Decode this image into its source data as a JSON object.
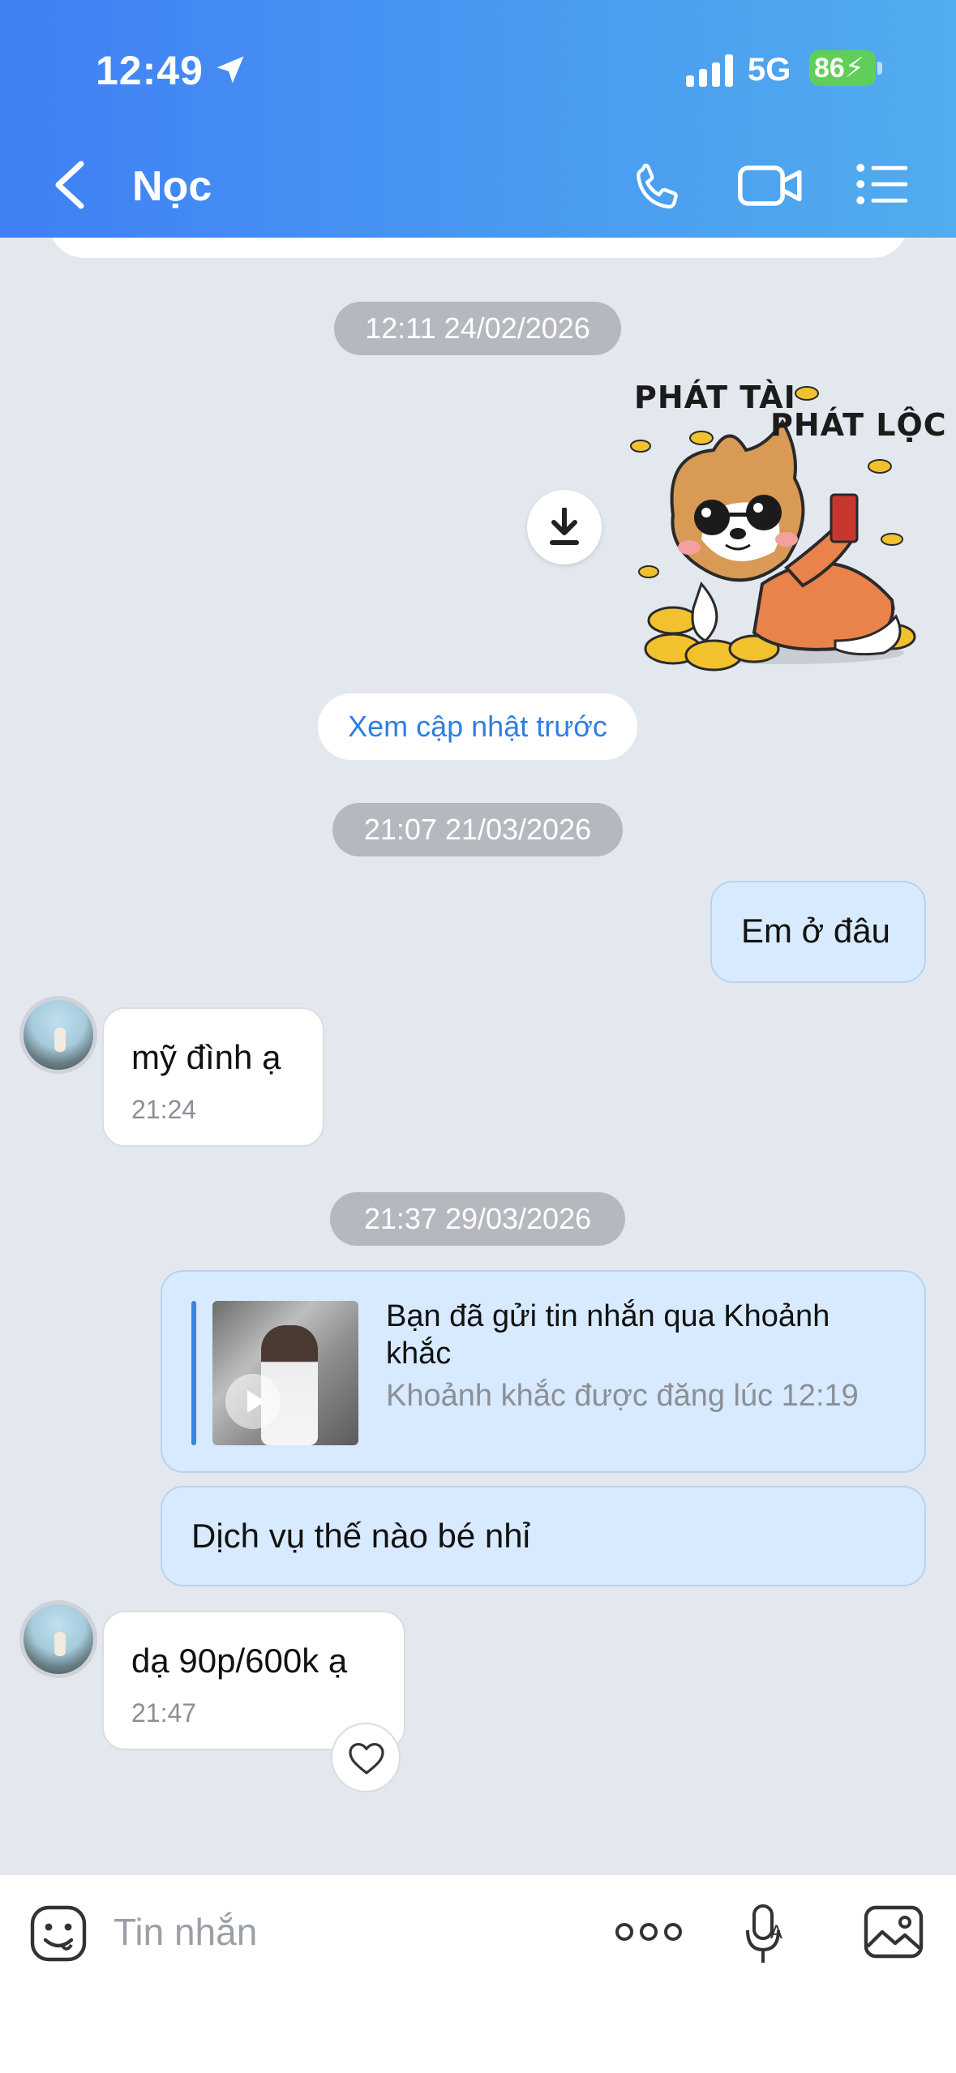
{
  "status_bar": {
    "time": "12:49",
    "network": "5G",
    "battery": "86"
  },
  "header": {
    "title": "Nọc"
  },
  "messages": {
    "timestamp1": "12:11 24/02/2026",
    "sticker_text_line1": "PHÁT TÀI",
    "sticker_text_line2": "PHÁT LỘC",
    "see_previous": "Xem cập nhật trước",
    "timestamp2": "21:07 21/03/2026",
    "out1": "Em ở đâu",
    "in1_text": "mỹ đình ạ",
    "in1_time": "21:24",
    "timestamp3": "21:37 29/03/2026",
    "moment_title": "Bạn đã gửi tin nhắn qua Khoảnh khắc",
    "moment_sub": "Khoảnh khắc được đăng lúc 12:19",
    "out2": "Dịch vụ thế nào bé nhỉ",
    "in2_text": "dạ 90p/600k ạ",
    "in2_time": "21:47"
  },
  "composer": {
    "placeholder": "Tin nhắn"
  },
  "colors": {
    "header_start": "#3f80f5",
    "header_end": "#52acee",
    "outgoing_bubble": "#d7eaff",
    "link_blue": "#2f7fe0",
    "battery_green": "#5fcf5a"
  }
}
